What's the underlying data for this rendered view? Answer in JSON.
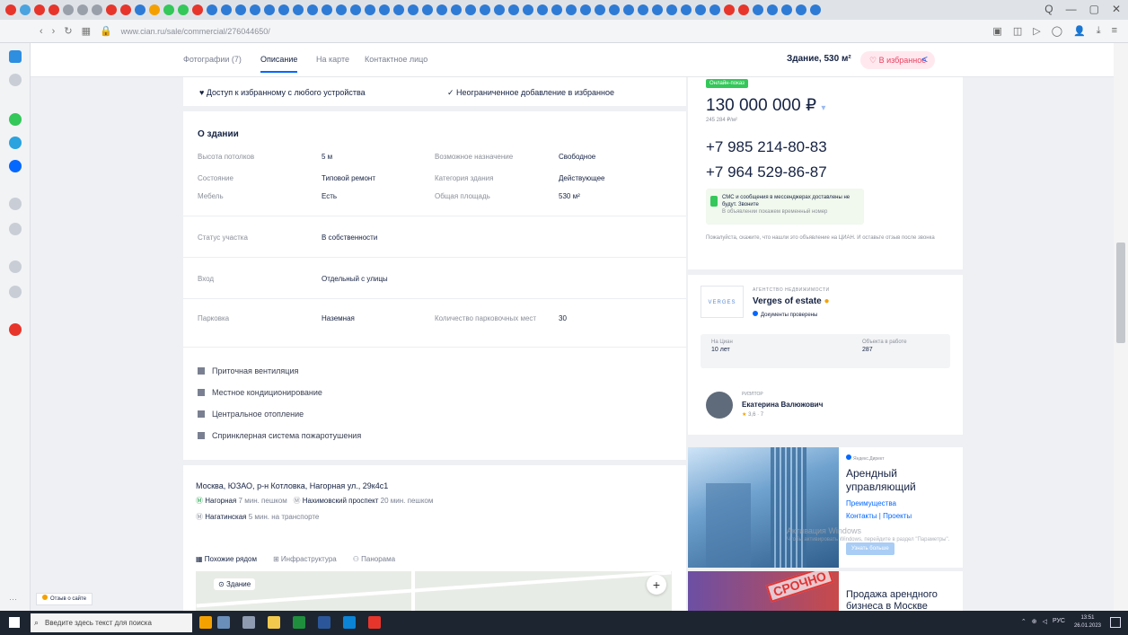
{
  "browser": {
    "url": "www.cian.ru/sale/commercial/276044650/",
    "window_controls": [
      "Q",
      "—",
      "▢",
      "✕"
    ]
  },
  "page_nav": {
    "items": [
      "Фотографии (7)",
      "Описание",
      "На карте",
      "Контактное лицо"
    ],
    "active_index": 1,
    "area_summary": "Здание, 530 м²",
    "favorite_label": "В избранное"
  },
  "access": {
    "left": "Доступ к избранному с любого устройства",
    "right": "Неограниченное добавление в избранное"
  },
  "building": {
    "title": "О здании",
    "props": [
      {
        "k": "Высота потолков",
        "v": "5 м"
      },
      {
        "k": "Возможное назначение",
        "v": "Свободное"
      },
      {
        "k": "Состояние",
        "v": "Типовой ремонт"
      },
      {
        "k": "Категория здания",
        "v": "Действующее"
      },
      {
        "k": "Мебель",
        "v": "Есть"
      },
      {
        "k": "Общая площадь",
        "v": "530 м²"
      }
    ],
    "land_status": {
      "k": "Статус участка",
      "v": "В собственности"
    },
    "entrance": {
      "k": "Вход",
      "v": "Отдельный с улицы"
    },
    "parking": {
      "k": "Парковка",
      "v": "Наземная"
    },
    "parking_spaces": {
      "k": "Количество парковочных мест",
      "v": "30"
    },
    "features": [
      "Приточная вентиляция",
      "Местное кондиционирование",
      "Центральное отопление",
      "Спринклерная система пожаротушения"
    ]
  },
  "address": {
    "line": "Москва, ЮЗАО, р-н Котловка, Нагорная ул., 29к4с1",
    "metro": [
      {
        "name": "Нагорная",
        "time": "7 мин. пешком"
      },
      {
        "name": "Нахимовский проспект",
        "time": "20 мин. пешком"
      },
      {
        "name": "Нагатинская",
        "time": "5 мин. на транспорте"
      }
    ],
    "map_tabs": [
      "Похожие рядом",
      "Инфраструктура",
      "Панорама"
    ],
    "map_pin": "Здание"
  },
  "price": {
    "badge": "Онлайн-показ",
    "value": "130 000 000 ₽",
    "per_m2": "245 284 ₽/м²",
    "phones": [
      "+7 985 214-80-83",
      "+7 964 529-86-87"
    ],
    "sms_title": "СМС и сообщения в мессенджерах доставлены не будут. Звоните",
    "sms_sub": "В объявлении покажем временный номер",
    "note": "Пожалуйста, скажите, что нашли это объявление на ЦИАН. И оставьте отзыв после звонка"
  },
  "agency": {
    "kind": "АГЕНТСТВО НЕДВИЖИМОСТИ",
    "logo_text": "VERGES",
    "name": "Verges of estate",
    "verified": "Документы проверены",
    "stats": [
      {
        "k": "На Циан",
        "v": "10 лет"
      },
      {
        "k": "Объекта в работе",
        "v": "287"
      }
    ]
  },
  "realtor": {
    "kind": "РИЭЛТОР",
    "name": "Екатерина Валюжович",
    "rating": "3,6 · 7"
  },
  "ads": [
    {
      "source": "Яндекс.Директ",
      "title": "Арендный управляющий",
      "link1": "Преимущества",
      "link2": "Контакты | Проекты",
      "button": "Узнать больше"
    },
    {
      "stamp": "СРОЧНО",
      "title": "Продажа арендного бизнеса в Москве"
    }
  ],
  "windows_activation": {
    "title": "Активация Windows",
    "sub": "Чтобы активировать Windows, перейдите в раздел \"Параметры\"."
  },
  "feedback_label": "Отзыв о сайте",
  "taskbar": {
    "search_placeholder": "Введите здесь текст для поиска",
    "lang": "РУС",
    "time": "13:51",
    "date": "26.01.2023"
  }
}
